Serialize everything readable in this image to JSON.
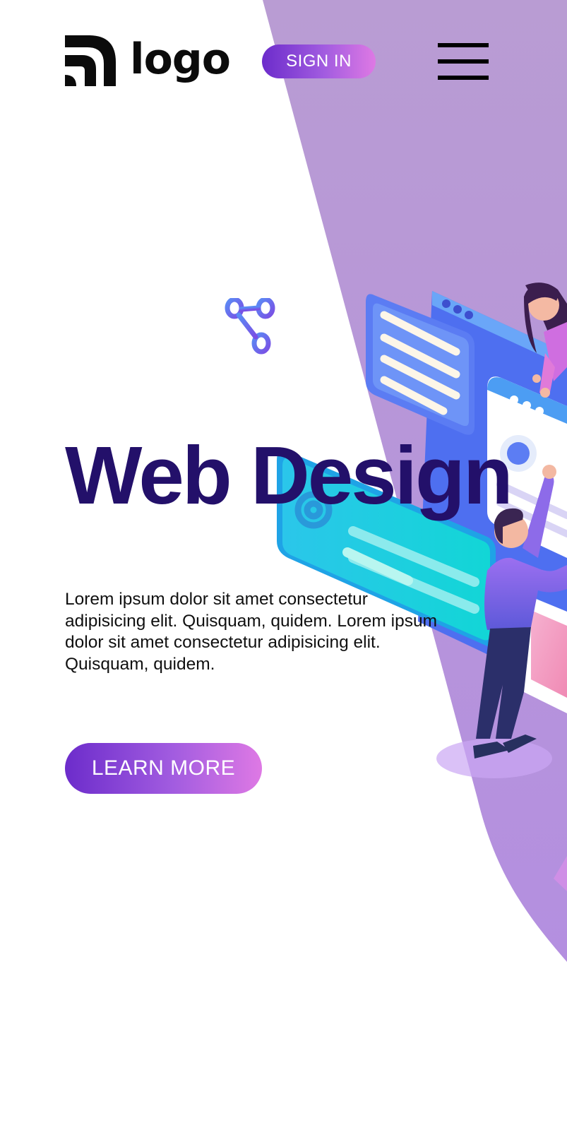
{
  "brand": {
    "logo_text": "logo",
    "logo_icon": "rss-arcs-icon"
  },
  "header": {
    "signin_label": "SIGN IN",
    "menu_icon": "hamburger-menu-icon"
  },
  "hero": {
    "share_icon": "share-icon",
    "title": "Web Design",
    "description": "Lorem ipsum dolor sit amet consectetur adipisicing elit. Quisquam, quidem. Lorem ipsum dolor sit amet consectetur adipisicing elit. Quisquam, quidem.",
    "cta_label": "LEARN MORE"
  },
  "colors": {
    "accent_start": "#6c2ccb",
    "accent_end": "#de79e4",
    "headline": "#23106a",
    "background_shape": "#b99bd6"
  }
}
